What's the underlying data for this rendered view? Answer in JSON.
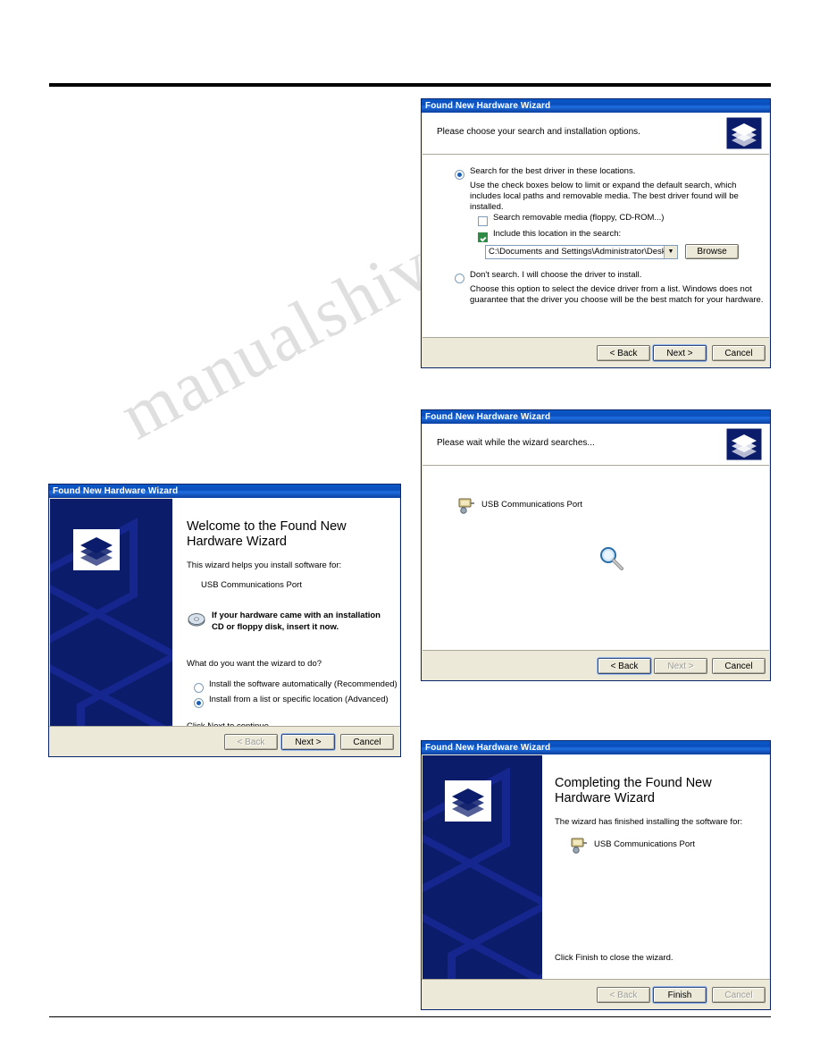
{
  "watermark": "manualshive.com",
  "dialogs": {
    "welcome": {
      "title": "Found New Hardware Wizard",
      "heading": "Welcome to the Found New Hardware Wizard",
      "line1": "This wizard helps you install software for:",
      "device": "USB Communications Port",
      "cd_note": "If your hardware came with an installation CD or floppy disk, insert it now.",
      "question": "What do you want the wizard to do?",
      "option_auto": "Install the software automatically (Recommended)",
      "option_list": "Install from a list or specific location (Advanced)",
      "footer": "Click Next to continue.",
      "back": "< Back",
      "next": "Next >",
      "cancel": "Cancel"
    },
    "search_options": {
      "title": "Found New Hardware Wizard",
      "heading": "Please choose your search and installation options.",
      "opt_search": "Search for the best driver in these locations.",
      "search_desc": "Use the check boxes below to limit or expand the default search, which includes local paths and removable media. The best driver found will be installed.",
      "chk_removable": "Search removable media (floppy, CD-ROM...)",
      "chk_location": "Include this location in the search:",
      "path_value": "C:\\Documents and Settings\\Administrator\\Desktop\\",
      "browse": "Browse",
      "opt_dontsearch": "Don't search. I will choose the driver to install.",
      "dontsearch_desc": "Choose this option to select the device driver from a list. Windows does not guarantee that the driver you choose will be the best match for your hardware.",
      "back": "< Back",
      "next": "Next >",
      "cancel": "Cancel"
    },
    "searching": {
      "title": "Found New Hardware Wizard",
      "heading": "Please wait while the wizard searches...",
      "device": "USB Communications Port",
      "back": "< Back",
      "next": "Next >",
      "cancel": "Cancel"
    },
    "complete": {
      "title": "Found New Hardware Wizard",
      "heading": "Completing the Found New Hardware Wizard",
      "line1": "The wizard has finished installing the software for:",
      "device": "USB Communications Port",
      "footer": "Click Finish to close the wizard.",
      "back": "< Back",
      "finish": "Finish",
      "cancel": "Cancel"
    }
  }
}
